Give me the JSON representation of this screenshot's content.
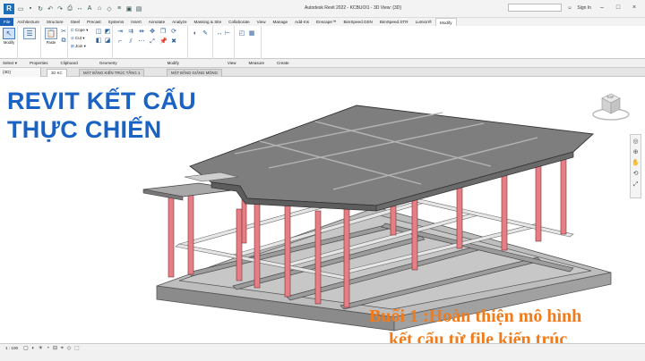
{
  "titlebar": {
    "app_logo": "R",
    "window_title": "Autodesk Revit 2022 - KCBUOI1 - 3D View: {3D}",
    "search_placeholder": "",
    "sign_in": "Sign In",
    "icons": [
      "open-icon",
      "save-icon",
      "sync-icon",
      "undo-icon",
      "redo-icon",
      "print-icon",
      "measure-icon",
      "text-icon",
      "3d-view-icon",
      "section-icon",
      "thin-lines-icon",
      "close-hidden-icon",
      "switch-windows-icon"
    ]
  },
  "tabs": [
    "File",
    "Architecture",
    "Structure",
    "Steel",
    "Precast",
    "Systems",
    "Insert",
    "Annotate",
    "Analyze",
    "Massing & Site",
    "Collaborate",
    "View",
    "Manage",
    "Add-Ins",
    "Enscape™",
    "BimSpeed.GEN",
    "BimSpeed.STR",
    "Lumion®",
    "Modify"
  ],
  "active_tab": "Modify",
  "ribbon": {
    "modify_label": "Modify",
    "properties_icon_label": "",
    "paste_label": "Paste",
    "cope_label": "Cope",
    "cut_label": "Cut",
    "join_label": "Join",
    "groups": [
      "Select",
      "Properties",
      "Clipboard",
      "Geometry",
      "Modify",
      "View",
      "Measure",
      "Create"
    ]
  },
  "optionsbar": {
    "select_label": "Select ▾",
    "properties_label": "Properties",
    "clipboard_label": "Clipboard"
  },
  "viewstrip": {
    "properties_tab": "{3D}",
    "view_tabs": [
      "3D KC",
      "MẶT BẰNG KIẾN TRÚC TẦNG 1",
      "MẶT BẰNG GIẰNG MÓNG"
    ],
    "active_index": 0
  },
  "overlay": {
    "title_line1": "REVIT KẾT CẤU",
    "title_line2": "THỰC CHIẾN",
    "subtitle_line1": "Buổi 1 :Hoàn thiện mô hình",
    "subtitle_line2": "kết cấu từ file kiến trúc"
  },
  "viewcube": {
    "face": "TOP"
  },
  "statusbar": {
    "scale": "1 : 100"
  }
}
